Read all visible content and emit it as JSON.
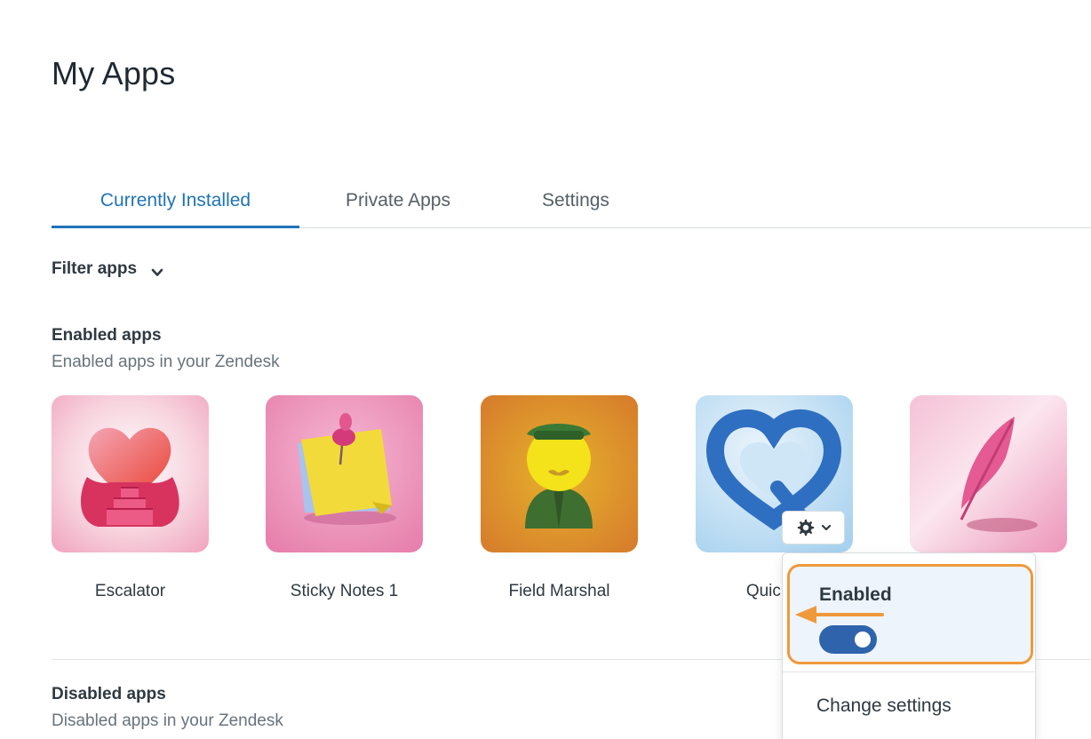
{
  "page": {
    "title": "My Apps"
  },
  "tabs": [
    {
      "label": "Currently Installed",
      "active": true
    },
    {
      "label": "Private Apps",
      "active": false
    },
    {
      "label": "Settings",
      "active": false
    }
  ],
  "filter": {
    "label": "Filter apps",
    "icon": "chevron-down-icon"
  },
  "enabled_section": {
    "title": "Enabled apps",
    "subtitle": "Enabled apps in your Zendesk"
  },
  "apps": [
    {
      "name": "Escalator",
      "icon": "heart-stairs-icon"
    },
    {
      "name": "Sticky Notes 1",
      "icon": "sticky-note-pin-icon"
    },
    {
      "name": "Field Marshal",
      "icon": "marshal-figure-icon"
    },
    {
      "name": "Quickie",
      "icon": "heart-q-icon"
    },
    {
      "name": "",
      "icon": "feather-icon"
    }
  ],
  "gear_menu": {
    "gear_icon": "gear-icon",
    "chevron_icon": "chevron-down-icon"
  },
  "dropdown": {
    "enabled_label": "Enabled",
    "toggle_state": "on",
    "change_settings_label": "Change settings"
  },
  "disabled_section": {
    "title": "Disabled apps",
    "subtitle": "Disabled apps in your Zendesk"
  },
  "colors": {
    "accent": "#1f73b7",
    "toggle": "#2f64ad",
    "highlight": "#f0993b",
    "highlight_bg": "#edf4fc"
  }
}
